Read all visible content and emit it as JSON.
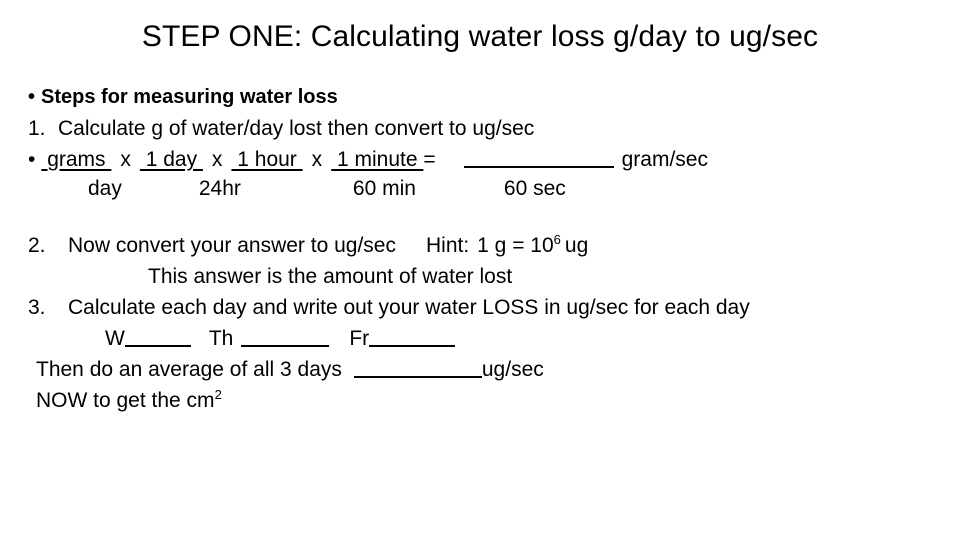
{
  "slide": {
    "title": "STEP ONE: Calculating water loss g/day to ug/sec",
    "background_color": "#ffffff",
    "text_color": "#000000"
  },
  "content": {
    "bullet_glyph": "•",
    "heading_bullet": "Steps for measuring water loss",
    "step1": {
      "marker": "1.",
      "text": "Calculate g of water/day lost then convert to ug/sec"
    },
    "conversion": {
      "bullet_glyph": "•",
      "numerators": [
        " grams ",
        " 1 day ",
        " 1 hour ",
        " 1 minute    "
      ],
      "denominators": [
        "day",
        "24hr",
        "60 min",
        "60 sec"
      ],
      "multiply_symbol": "x",
      "equals_symbol": "=",
      "answer_blank": "______",
      "answer_unit": "gram/sec"
    },
    "step2": {
      "marker": "2.",
      "text": "Now convert your answer to  ug/sec",
      "hint_label": "Hint:",
      "hint_value_pre": "1 g = 10",
      "hint_exponent": "6",
      "hint_value_post": "ug",
      "subtext": "This answer is the amount of water lost"
    },
    "step3": {
      "marker": "3.",
      "text": "Calculate each day and write out your water LOSS in ug/sec for each day",
      "days": [
        {
          "label": "W",
          "blank": "______"
        },
        {
          "label": "Th",
          "blank": "_____"
        },
        {
          "label": "Fr",
          "blank": "______"
        }
      ]
    },
    "average_line": {
      "text": "Then do an average of all 3 days",
      "blank": "_______",
      "unit": "ug/sec"
    },
    "final_line": {
      "text_pre": "NOW to get the cm",
      "exponent": "2"
    }
  }
}
